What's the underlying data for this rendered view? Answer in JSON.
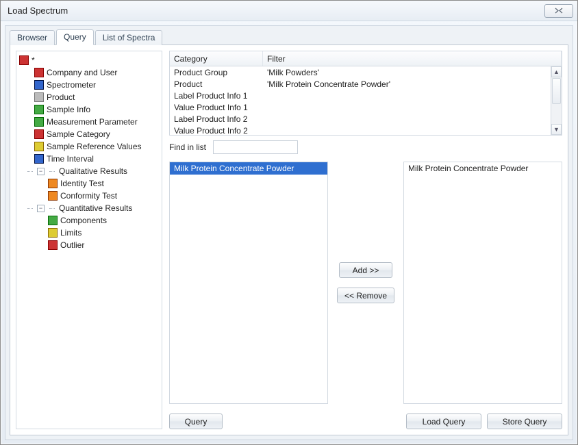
{
  "window": {
    "title": "Load Spectrum"
  },
  "tabs": {
    "browser": "Browser",
    "query": "Query",
    "list": "List of Spectra",
    "active": "query"
  },
  "tree": {
    "root": "*",
    "items": [
      {
        "label": "Company and User",
        "icon": "red",
        "name": "company-and-user"
      },
      {
        "label": "Spectrometer",
        "icon": "blue",
        "name": "spectrometer"
      },
      {
        "label": "Product",
        "icon": "gray",
        "name": "product"
      },
      {
        "label": "Sample Info",
        "icon": "green",
        "name": "sample-info"
      },
      {
        "label": "Measurement Parameter",
        "icon": "green",
        "name": "measurement-parameter"
      },
      {
        "label": "Sample Category",
        "icon": "red",
        "name": "sample-category"
      },
      {
        "label": "Sample Reference Values",
        "icon": "yellow",
        "name": "sample-reference-values"
      },
      {
        "label": "Time Interval",
        "icon": "blue",
        "name": "time-interval"
      }
    ],
    "qualitative": {
      "label": "Qualitative Results",
      "children": [
        {
          "label": "Identity Test",
          "icon": "orange"
        },
        {
          "label": "Conformity Test",
          "icon": "orange"
        }
      ]
    },
    "quantitative": {
      "label": "Quantitative Results",
      "children": [
        {
          "label": "Components",
          "icon": "green"
        },
        {
          "label": "Limits",
          "icon": "yellow"
        },
        {
          "label": "Outlier",
          "icon": "red"
        }
      ]
    }
  },
  "filterTable": {
    "header": {
      "category": "Category",
      "filter": "Filter"
    },
    "rows": [
      {
        "category": "Product Group",
        "filter": "'Milk Powders'"
      },
      {
        "category": "Product",
        "filter": "'Milk Protein Concentrate Powder'"
      },
      {
        "category": "Label Product Info 1",
        "filter": ""
      },
      {
        "category": "Value Product Info 1",
        "filter": ""
      },
      {
        "category": "Label Product Info 2",
        "filter": ""
      },
      {
        "category": "Value Product Info 2",
        "filter": ""
      }
    ]
  },
  "find": {
    "label": "Find in list",
    "value": ""
  },
  "leftList": {
    "items": [
      {
        "label": "Milk Protein Concentrate Powder",
        "selected": true
      }
    ]
  },
  "rightList": {
    "items": [
      {
        "label": "Milk Protein Concentrate Powder",
        "selected": false
      }
    ]
  },
  "buttons": {
    "add": "Add >>",
    "remove": "<< Remove",
    "query": "Query",
    "loadQuery": "Load Query",
    "storeQuery": "Store Query"
  }
}
